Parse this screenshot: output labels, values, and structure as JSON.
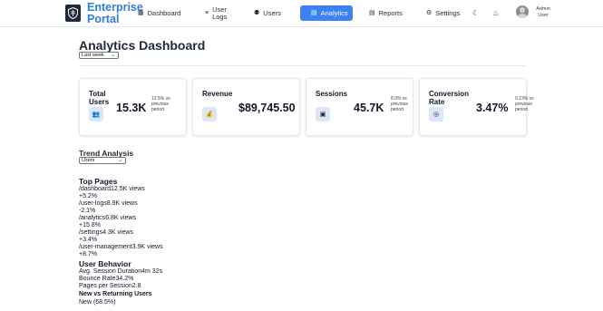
{
  "header": {
    "brand": "Enterprise Portal",
    "nav": [
      {
        "label": "Dashboard",
        "icon": "grid-icon"
      },
      {
        "label": "User Logs",
        "icon": "list-icon"
      },
      {
        "label": "Users",
        "icon": "users-icon"
      },
      {
        "label": "Analytics",
        "icon": "chart-icon",
        "active": true
      },
      {
        "label": "Reports",
        "icon": "document-icon"
      },
      {
        "label": "Settings",
        "icon": "gear-icon"
      }
    ],
    "user_name": "Admin User",
    "accent_color": "#3b82f6",
    "brand_color": "#2f7de1"
  },
  "page": {
    "title": "Analytics Dashboard",
    "range_selected": "Last week"
  },
  "cards": [
    {
      "label": "Total Users",
      "value": "15.3K",
      "change": "12.5% vs previous period",
      "icon": "users-icon"
    },
    {
      "label": "Revenue",
      "value": "$89,745.50",
      "change": "",
      "icon": "money-bag-icon"
    },
    {
      "label": "Sessions",
      "value": "45.7K",
      "change": "8.9% vs previous period",
      "icon": "session-icon"
    },
    {
      "label": "Conversion Rate",
      "value": "3.47%",
      "change": "0.23% vs previous period",
      "icon": "target-icon"
    }
  ],
  "trend": {
    "title": "Trend Analysis",
    "metric_selected": "Users"
  },
  "top_pages": {
    "title": "Top Pages",
    "items": [
      {
        "path": "/dashboard",
        "views": "12.5K views",
        "change": "+5.2%"
      },
      {
        "path": "/user-logs",
        "views": "8.9K views",
        "change": "-2.1%"
      },
      {
        "path": "/analytics",
        "views": "6.8K views",
        "change": "+15.8%"
      },
      {
        "path": "/settings",
        "views": "4.3K views",
        "change": "+3.4%"
      },
      {
        "path": "/user-management",
        "views": "3.9K views",
        "change": "+8.7%"
      }
    ]
  },
  "behavior": {
    "title": "User Behavior",
    "metrics": [
      {
        "label": "Avg. Session Duration",
        "value": "4m 32s"
      },
      {
        "label": "Bounce Rate",
        "value": "34.2%"
      },
      {
        "label": "Pages per Session",
        "value": "2.8"
      }
    ],
    "returning_title": "New vs Returning Users",
    "returning_first": "New (68.5%)"
  }
}
